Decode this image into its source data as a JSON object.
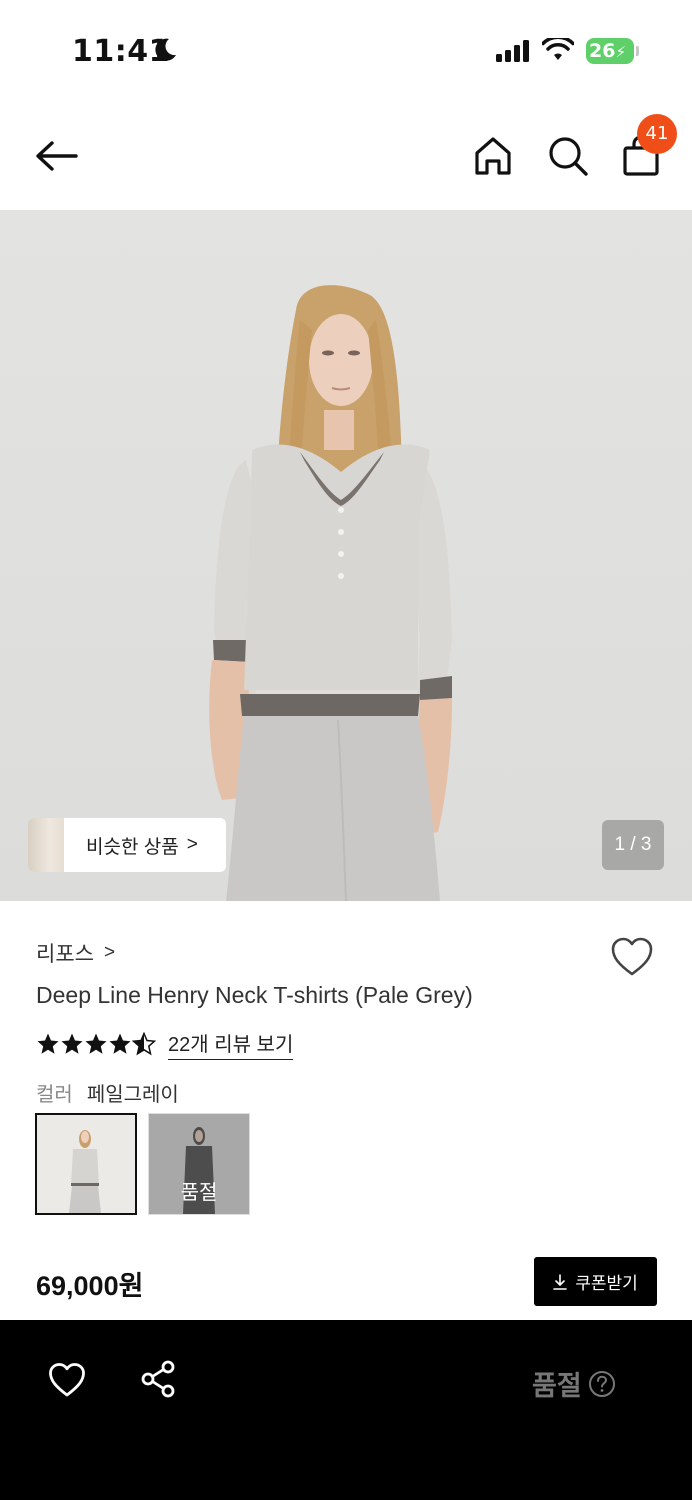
{
  "status_bar": {
    "time": "11:41",
    "battery": "26",
    "icons": [
      "moon-icon",
      "signal-icon",
      "wifi-icon",
      "battery-icon"
    ]
  },
  "header": {
    "icons": [
      "back-arrow-icon",
      "home-icon",
      "search-icon",
      "shopping-bag-icon"
    ],
    "cart_count": "41",
    "badge_color": "#f04e18"
  },
  "hero": {
    "similar_label": "비슷한 상품",
    "similar_chevron": ">",
    "page_indicator": "1 / 3"
  },
  "product": {
    "brand": "리포스",
    "brand_chevron": ">",
    "name": "Deep Line Henry Neck T-shirts (Pale Grey)",
    "rating_stars": 4.5,
    "review_link": "22개 리뷰 보기",
    "color_label": "컬러",
    "color_value": "페일그레이",
    "swatches": [
      {
        "name": "pale-grey",
        "selected": true,
        "soldout_label": ""
      },
      {
        "name": "charcoal",
        "selected": false,
        "soldout_label": "품절"
      }
    ],
    "price": "69,000원",
    "coupon_label": "쿠폰받기"
  },
  "bottom_bar": {
    "status": "품절",
    "icons": [
      "heart-icon",
      "share-icon",
      "help-icon"
    ]
  }
}
